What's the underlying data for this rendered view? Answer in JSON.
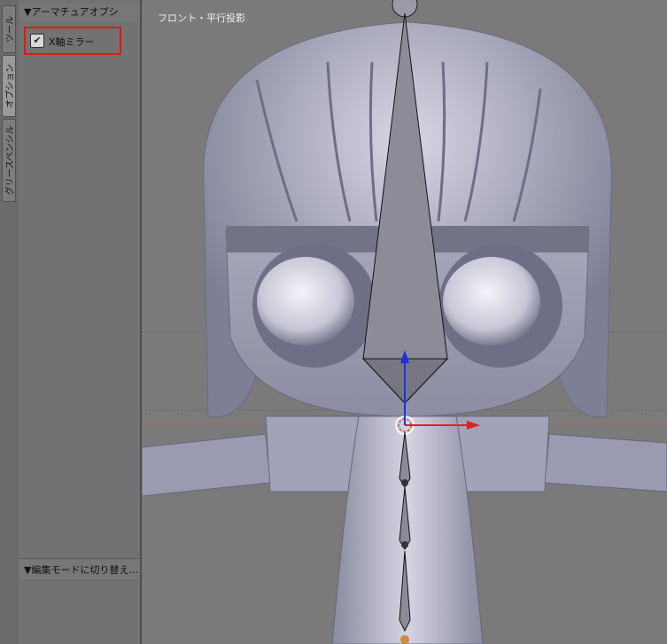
{
  "tabs": [
    {
      "label": "ツール"
    },
    {
      "label": "オプション"
    },
    {
      "label": "グリースペンシル"
    }
  ],
  "panel": {
    "armature_header": "▼アーマチュアオプシ",
    "x_mirror_label": "X軸ミラー",
    "x_mirror_checked": true,
    "edit_mode_header": "▼編集モードに切り替え..."
  },
  "viewport": {
    "view_label": "フロント・平行投影"
  },
  "colors": {
    "highlight_box": "#e01818",
    "axis_x": "#e02020",
    "axis_z": "#2030e0",
    "mesh": "#b4b4c8"
  }
}
